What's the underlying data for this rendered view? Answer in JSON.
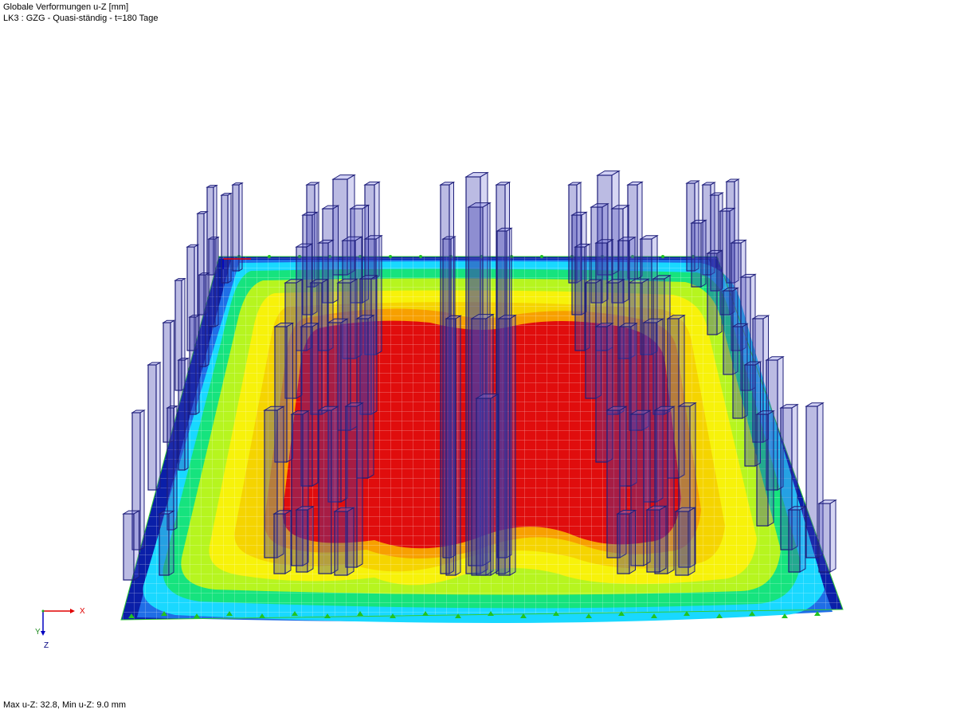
{
  "header": {
    "result_title": "Globale Verformungen u-Z [mm]",
    "load_case": "LK3 : GZG - Quasi-ständig - t=180 Tage"
  },
  "footer": {
    "extremes": "Max u-Z: 32.8, Min u-Z: 9.0 mm"
  },
  "axes": {
    "x_label": "X",
    "y_label": "Y",
    "z_label": "Z"
  },
  "colors": {
    "contour_bands": [
      "#0a1fa8",
      "#1f6ee6",
      "#19d8ff",
      "#16e37e",
      "#19c812",
      "#b6f51f",
      "#f7f20a",
      "#f7d200",
      "#f7a000",
      "#ee4014",
      "#e00d0d"
    ],
    "column": "#2b2b8f",
    "mesh": "#ffffff",
    "support": "#21c321",
    "axis_x": "#e00000",
    "axis_z": "#0000c0"
  }
}
